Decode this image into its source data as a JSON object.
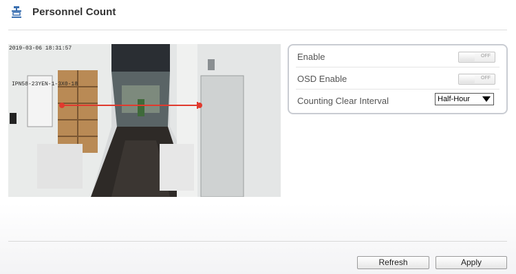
{
  "header": {
    "title": "Personnel Count",
    "icon": "counter-icon"
  },
  "video": {
    "osd_timestamp": "2019-03-06 18:31:57",
    "osd_model": "IPN58-23YEN-1-3X0-18"
  },
  "settings": {
    "rows": [
      {
        "label": "Enable",
        "type": "toggle",
        "state": "OFF"
      },
      {
        "label": "OSD Enable",
        "type": "toggle",
        "state": "OFF"
      },
      {
        "label": "Counting Clear Interval",
        "type": "select",
        "value": "Half-Hour"
      }
    ]
  },
  "footer": {
    "refresh_label": "Refresh",
    "apply_label": "Apply"
  },
  "colors": {
    "count_line": "#e03a2e",
    "panel_border": "#c9ccd2"
  }
}
